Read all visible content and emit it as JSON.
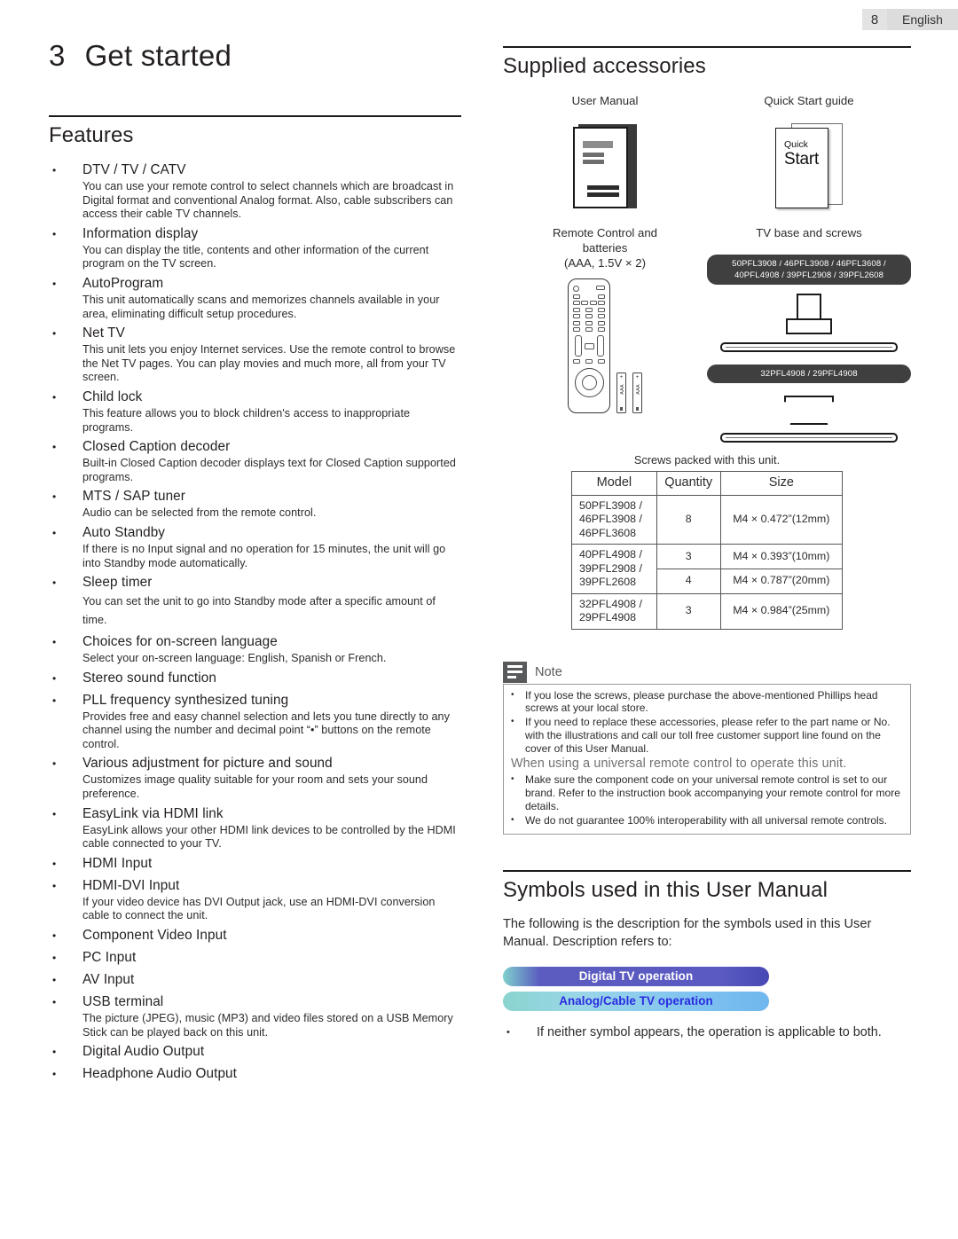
{
  "header": {
    "page_number": "8",
    "language": "English"
  },
  "chapter": {
    "number": "3",
    "title": "Get started"
  },
  "features": {
    "heading": "Features",
    "items": [
      {
        "title": "DTV / TV / CATV",
        "desc": "You can use your remote control to select channels which are broadcast in Digital format and conventional Analog format. Also, cable subscribers can access their cable TV channels."
      },
      {
        "title": "Information display",
        "desc": "You can display the title, contents and other information of the current program on the TV screen."
      },
      {
        "title": "AutoProgram",
        "desc": "This unit automatically scans and memorizes channels available in your area, eliminating difficult setup procedures."
      },
      {
        "title": "Net TV",
        "desc": "This unit lets you enjoy Internet services. Use the remote control to browse the Net TV pages. You can play movies and much more, all from your TV screen."
      },
      {
        "title": "Child lock",
        "desc": "This feature allows you to block children's access to inappropriate programs."
      },
      {
        "title": "Closed Caption decoder",
        "desc": "Built-in Closed Caption decoder displays text for Closed Caption supported programs."
      },
      {
        "title": "MTS / SAP tuner",
        "desc": "Audio can be selected from the remote control."
      },
      {
        "title": "Auto Standby",
        "desc": "If there is no Input signal and no operation for 15 minutes, the unit will go into Standby mode automatically."
      },
      {
        "title": "Sleep timer",
        "desc": "You can set the unit to go into Standby mode after a specific amount of time."
      },
      {
        "title": "Choices for on-screen language",
        "desc": "Select your on-screen language: English, Spanish or French."
      },
      {
        "title": "Stereo sound function",
        "desc": ""
      },
      {
        "title": "PLL frequency synthesized tuning",
        "desc": "Provides free and easy channel selection and lets you tune directly to any channel using the number and decimal point “•” buttons on the remote control."
      },
      {
        "title": "Various adjustment for picture and sound",
        "desc": "Customizes image quality suitable for your room and sets your sound preference."
      },
      {
        "title": "EasyLink via HDMI link",
        "desc": "EasyLink allows your other HDMI link devices to be controlled by the HDMI cable connected to your TV."
      },
      {
        "title": "HDMI Input",
        "desc": ""
      },
      {
        "title": "HDMI-DVI Input",
        "desc": "If your video device has DVI Output jack, use an HDMI-DVI conversion cable to connect the unit."
      },
      {
        "title": "Component Video Input",
        "desc": ""
      },
      {
        "title": "PC Input",
        "desc": ""
      },
      {
        "title": "AV Input",
        "desc": ""
      },
      {
        "title": "USB terminal",
        "desc": "The picture (JPEG), music (MP3) and video files stored on a USB Memory Stick can be played back on this unit."
      },
      {
        "title": "Digital Audio Output",
        "desc": ""
      },
      {
        "title": "Headphone Audio Output",
        "desc": ""
      }
    ]
  },
  "accessories": {
    "heading": "Supplied accessories",
    "user_manual_label": "User Manual",
    "quick_start_label": "Quick Start guide",
    "quick_start_art": {
      "line1": "Quick",
      "line2": "Start"
    },
    "remote_label_line1": "Remote Control and",
    "remote_label_line2": "batteries",
    "remote_label_line3": "(AAA, 1.5V × 2)",
    "battery_label": "AAA",
    "battery_plus": "+",
    "tv_base_label": "TV base and screws",
    "model_badge_1_line1": "50PFL3908 / 46PFL3908 / 46PFL3608 /",
    "model_badge_1_line2": "40PFL4908 / 39PFL2908 / 39PFL2608",
    "model_badge_2": "32PFL4908 / 29PFL4908"
  },
  "screws": {
    "caption": "Screws packed with this unit.",
    "columns": [
      "Model",
      "Quantity",
      "Size"
    ],
    "rows": [
      {
        "model": "50PFL3908 /\n46PFL3908 /\n46PFL3608",
        "quantity": "8",
        "size": "M4 × 0.472”(12mm)"
      },
      {
        "model": "40PFL4908 /\n39PFL2908 /\n39PFL2608",
        "quantity": "3",
        "size": "M4 × 0.393”(10mm)"
      },
      {
        "model": "",
        "quantity": "4",
        "size": "M4 × 0.787”(20mm)"
      },
      {
        "model": "32PFL4908 /\n29PFL4908",
        "quantity": "3",
        "size": "M4 × 0.984”(25mm)"
      }
    ]
  },
  "note": {
    "title": "Note",
    "items_before": [
      "If you lose the screws, please purchase the above-mentioned Phillips head screws at your local store.",
      "If you need to replace these accessories, please refer to the part name or No. with the illustrations and call our toll free customer support line found on the cover of this User Manual."
    ],
    "subheading": "When using a universal remote control to operate this unit.",
    "items_after": [
      "Make sure the component code on your universal remote control is set to our brand. Refer to the instruction book accompanying your remote control for more details.",
      "We do not guarantee 100% interoperability with all universal remote controls."
    ]
  },
  "symbols": {
    "heading": "Symbols used in this User Manual",
    "intro": "The following is the description for the symbols used in this User Manual. Description refers to:",
    "digital_badge": "Digital TV operation",
    "analog_badge": "Analog/Cable TV operation",
    "footnote": "If neither symbol appears, the operation is applicable to both.",
    "colors": {
      "digital_text": "#ffffff",
      "analog_text": "#2b2be0",
      "badge_dark": "#3f3f3f"
    }
  }
}
